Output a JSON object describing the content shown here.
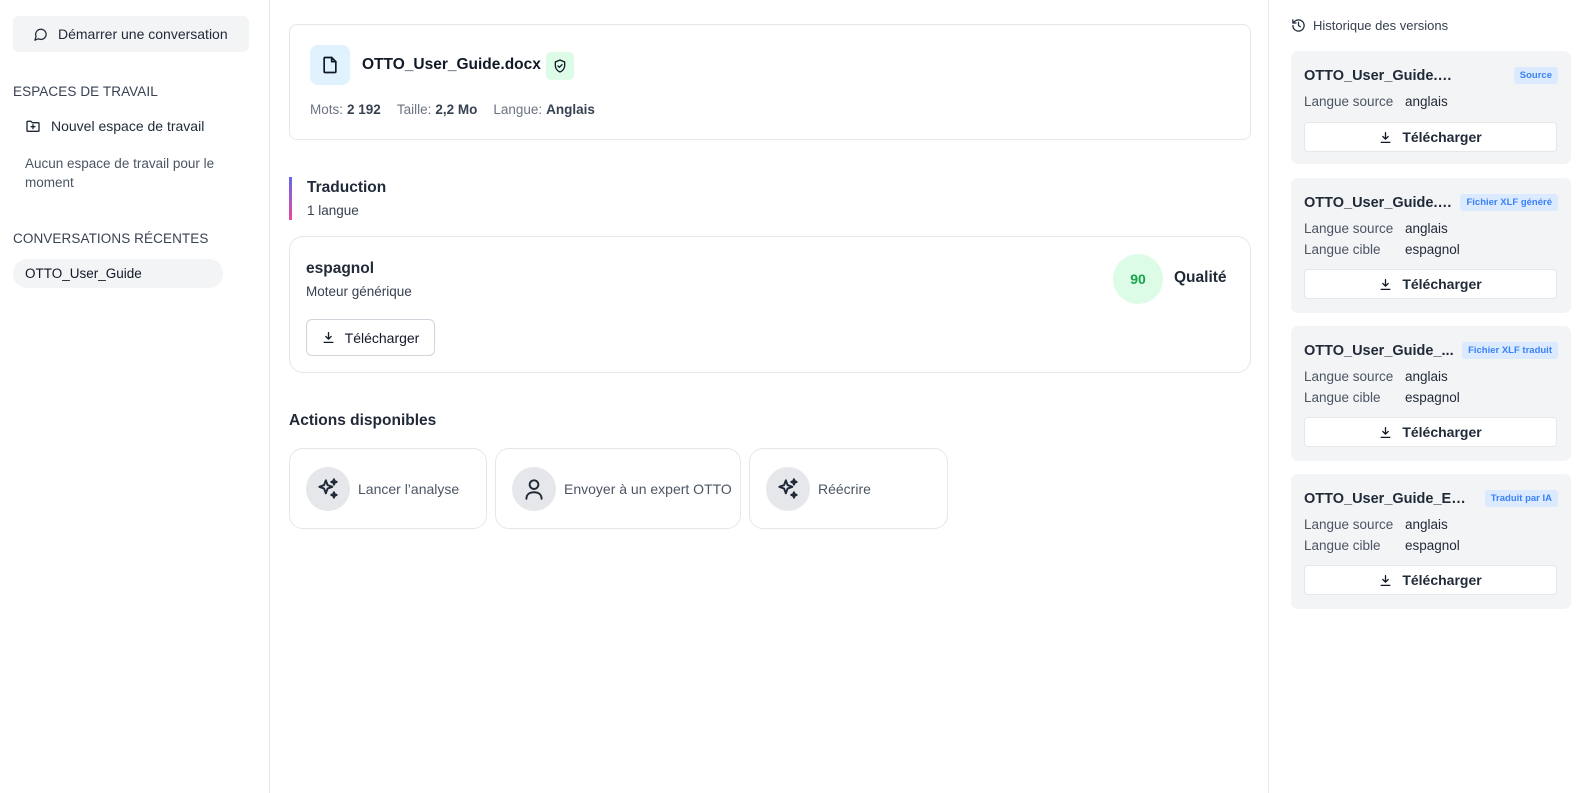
{
  "sidebar": {
    "new_conversation": "Démarrer une conversation",
    "workspaces_title": "ESPACES DE TRAVAIL",
    "new_workspace": "Nouvel espace de travail",
    "no_workspace": "Aucun espace de travail pour le moment",
    "recent_title": "CONVERSATIONS RÉCENTES",
    "recent_items": [
      "OTTO_User_Guide"
    ]
  },
  "file": {
    "name": "OTTO_User_Guide.docx",
    "words_label": "Mots:",
    "words": "2 192",
    "size_label": "Taille:",
    "size": "2,2 Mo",
    "lang_label": "Langue:",
    "lang": "Anglais"
  },
  "translation": {
    "title": "Traduction",
    "subtitle": "1 langue",
    "language": "espagnol",
    "engine": "Moteur générique",
    "score": "90",
    "quality_label": "Qualité",
    "download": "Télécharger"
  },
  "actions": {
    "title": "Actions disponibles",
    "items": [
      "Lancer l’analyse",
      "Envoyer à un expert OTTO",
      "Réécrire"
    ]
  },
  "history": {
    "title": "Historique des versions",
    "versions": [
      {
        "name": "OTTO_User_Guide.docx",
        "badge": "Source",
        "source_label": "Langue source",
        "source": "anglais",
        "download": "Télécharger"
      },
      {
        "name": "OTTO_User_Guide.d...",
        "badge": "Fichier XLF généré",
        "source_label": "Langue source",
        "source": "anglais",
        "target_label": "Langue cible",
        "target": "espagnol",
        "download": "Télécharger"
      },
      {
        "name": "OTTO_User_Guide_...",
        "badge": "Fichier XLF traduit",
        "source_label": "Langue source",
        "source": "anglais",
        "target_label": "Langue cible",
        "target": "espagnol",
        "download": "Télécharger"
      },
      {
        "name": "OTTO_User_Guide_EN_...",
        "badge": "Traduit par IA",
        "source_label": "Langue source",
        "source": "anglais",
        "target_label": "Langue cible",
        "target": "espagnol",
        "download": "Télécharger"
      }
    ]
  },
  "colors": {
    "accent_bar_start": "#6366f1",
    "accent_bar_end": "#ec4899",
    "score_bg": "#dcfce7",
    "score_text": "#16a34a",
    "badge_bg": "#dbeafe",
    "badge_text": "#3b82f6"
  }
}
